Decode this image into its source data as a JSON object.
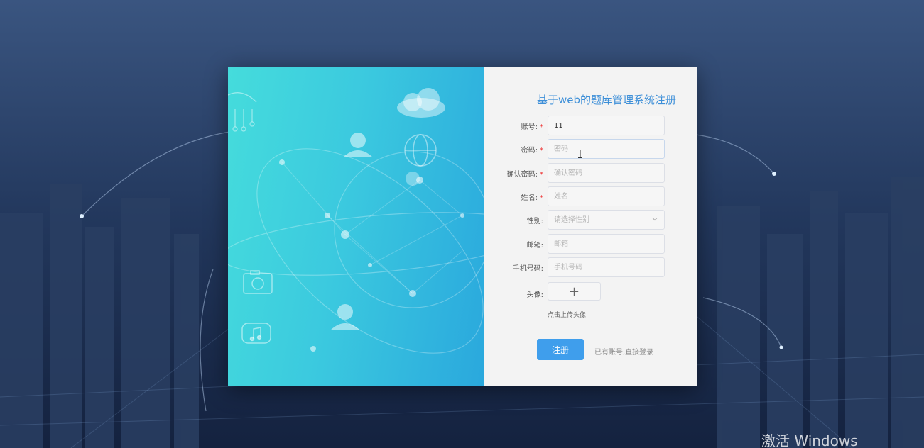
{
  "form": {
    "title": "基于web的题库管理系统注册",
    "fields": [
      {
        "label": "账号:",
        "required": true,
        "value": "11",
        "placeholder": ""
      },
      {
        "label": "密码:",
        "required": true,
        "value": "",
        "placeholder": "密码"
      },
      {
        "label": "确认密码:",
        "required": true,
        "value": "",
        "placeholder": "确认密码"
      },
      {
        "label": "姓名:",
        "required": true,
        "value": "",
        "placeholder": "姓名"
      },
      {
        "label": "性别:",
        "required": false,
        "value": "",
        "placeholder": "请选择性别"
      },
      {
        "label": "邮箱:",
        "required": false,
        "value": "",
        "placeholder": "邮箱"
      },
      {
        "label": "手机号码:",
        "required": false,
        "value": "",
        "placeholder": "手机号码"
      }
    ],
    "avatar_label": "头像:",
    "upload_symbol": "+",
    "upload_hint": "点击上传头像",
    "register_label": "注册",
    "login_link": "已有账号,直接登录",
    "required_mark": "*"
  },
  "watermark": "激活 Windows",
  "colors": {
    "title": "#3d8fd8",
    "button": "#3f9eec",
    "required": "#e33333",
    "panel_left_start": "#45dcdc",
    "panel_left_end": "#2aa8dd"
  },
  "icons": [
    "cloud-icon",
    "user-icon",
    "globe-icon",
    "camera-icon",
    "music-icon",
    "select-chevron-icon",
    "plus-icon"
  ]
}
